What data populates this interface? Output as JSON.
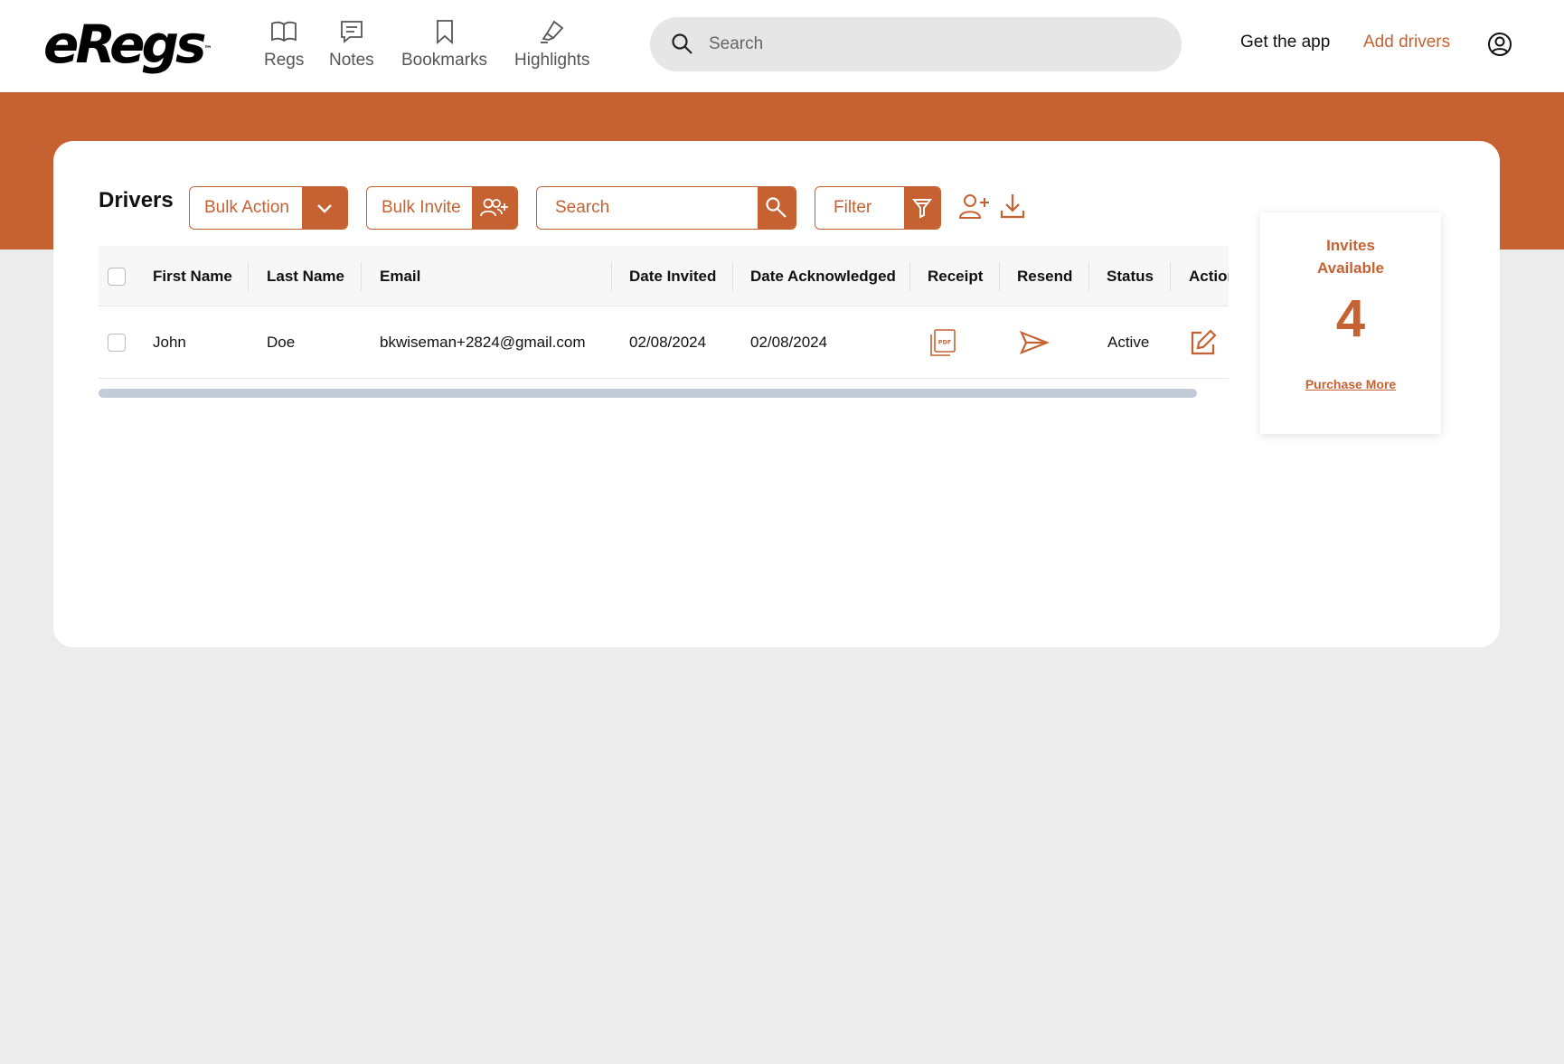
{
  "brand": {
    "logo_text": "eRegs",
    "trademark": "™"
  },
  "nav": [
    {
      "label": "Regs",
      "icon": "book-open-icon"
    },
    {
      "label": "Notes",
      "icon": "chat-note-icon"
    },
    {
      "label": "Bookmarks",
      "icon": "bookmark-icon"
    },
    {
      "label": "Highlights",
      "icon": "highlighter-icon"
    }
  ],
  "search": {
    "placeholder": "Search",
    "value": ""
  },
  "header_links": {
    "get_app": "Get the app",
    "add_drivers": "Add drivers"
  },
  "colors": {
    "accent": "#c66232",
    "page_bg": "#ececec",
    "header_bg": "#ffffff"
  },
  "drivers": {
    "title": "Drivers",
    "bulk_action_label": "Bulk Action",
    "bulk_invite_label": "Bulk Invite",
    "search_placeholder": "Search",
    "filter_label": "Filter",
    "columns": [
      "First Name",
      "Last Name",
      "Email",
      "Date Invited",
      "Date Acknowledged",
      "Receipt",
      "Resend",
      "Status",
      "Action"
    ],
    "rows": [
      {
        "first_name": "John",
        "last_name": "Doe",
        "email": "bkwiseman+2824@gmail.com",
        "date_invited": "02/08/2024",
        "date_acknowledged": "02/08/2024",
        "receipt_icon": "pdf-icon",
        "resend_icon": "send-icon",
        "status": "Active",
        "action_icon": "edit-icon"
      }
    ]
  },
  "invites": {
    "heading_line1": "Invites",
    "heading_line2": "Available",
    "count": "4",
    "purchase_label": "Purchase More"
  }
}
